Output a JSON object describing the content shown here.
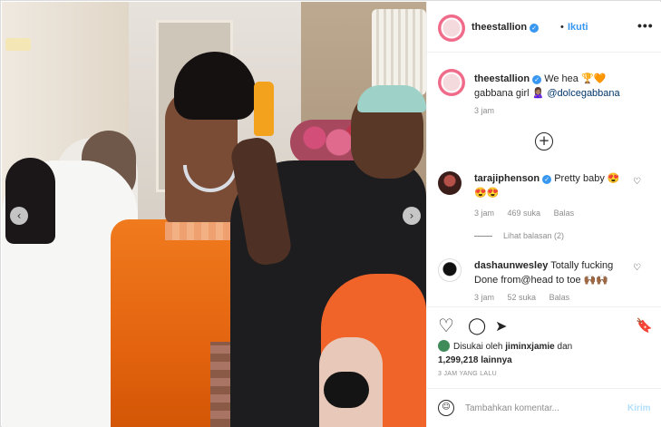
{
  "post": {
    "username": "theestallion",
    "follow_dot": "•",
    "follow_label": "Ikuti",
    "more_label": "•••"
  },
  "caption": {
    "username": "theestallion",
    "text_part1": "We hea 🏆🧡",
    "text_part2": "gabbana girl 🙎🏽‍♀️ ",
    "mention": "@dolcegabbana",
    "time": "3 jam"
  },
  "comments": [
    {
      "username": "tarajiphenson",
      "text": "Pretty baby 😍",
      "text2": "😍😍",
      "time": "3 jam",
      "likes": "469 suka",
      "reply_label": "Balas",
      "view_replies": "Lihat balasan (2)"
    },
    {
      "username": "dashaunwesley",
      "text": "Totally fucking",
      "text2": "Done from@head to toe 🙌🏾🙌🏾",
      "time": "3 jam",
      "likes": "52 suka",
      "reply_label": "Balas"
    }
  ],
  "likes": {
    "prefix": "Disukai oleh ",
    "user": "jiminxjamie",
    "suffix": " dan",
    "count": "1,299,218 lainnya"
  },
  "post_time": "3 JAM YANG LALU",
  "composer": {
    "placeholder": "Tambahkan komentar...",
    "post_label": "Kirim"
  },
  "icons": {
    "prev": "‹",
    "next": "›",
    "load_more": "+",
    "heart": "♡",
    "comment": "◯",
    "share": "➤",
    "bookmark": "🔖",
    "emoji": "☺",
    "verified": "✓"
  },
  "colors": {
    "link": "#00376b",
    "follow": "#3897f0",
    "muted": "#8e8e8e",
    "dress": "#e4640f"
  }
}
